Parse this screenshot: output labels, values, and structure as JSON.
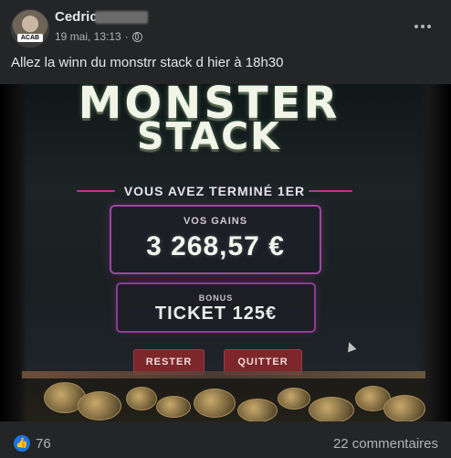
{
  "post": {
    "author": "Cedric",
    "date": "19 mai, 13:13",
    "meta_separator": "·",
    "privacy_icon": "globe-icon",
    "text": "Allez la winn du monstrr stack d hier à 18h30"
  },
  "avatar": {
    "tag_text": "ACAB"
  },
  "photo": {
    "title_line1": "MONSTER",
    "title_line2": "STACK",
    "status": "VOUS AVEZ TERMINÉ 1ER",
    "gains_label": "VOS GAINS",
    "gains_value": "3 268,57 €",
    "bonus_label": "BONUS",
    "bonus_value": "TICKET 125€",
    "stay_button": "RESTER",
    "quit_button": "QUITTER",
    "colors": {
      "accent_purple": "#9e48a2",
      "button_red": "#7d262b"
    }
  },
  "footer": {
    "likes": "76",
    "comments": "22 commentaires",
    "like_icon": "thumbs-up-icon"
  }
}
